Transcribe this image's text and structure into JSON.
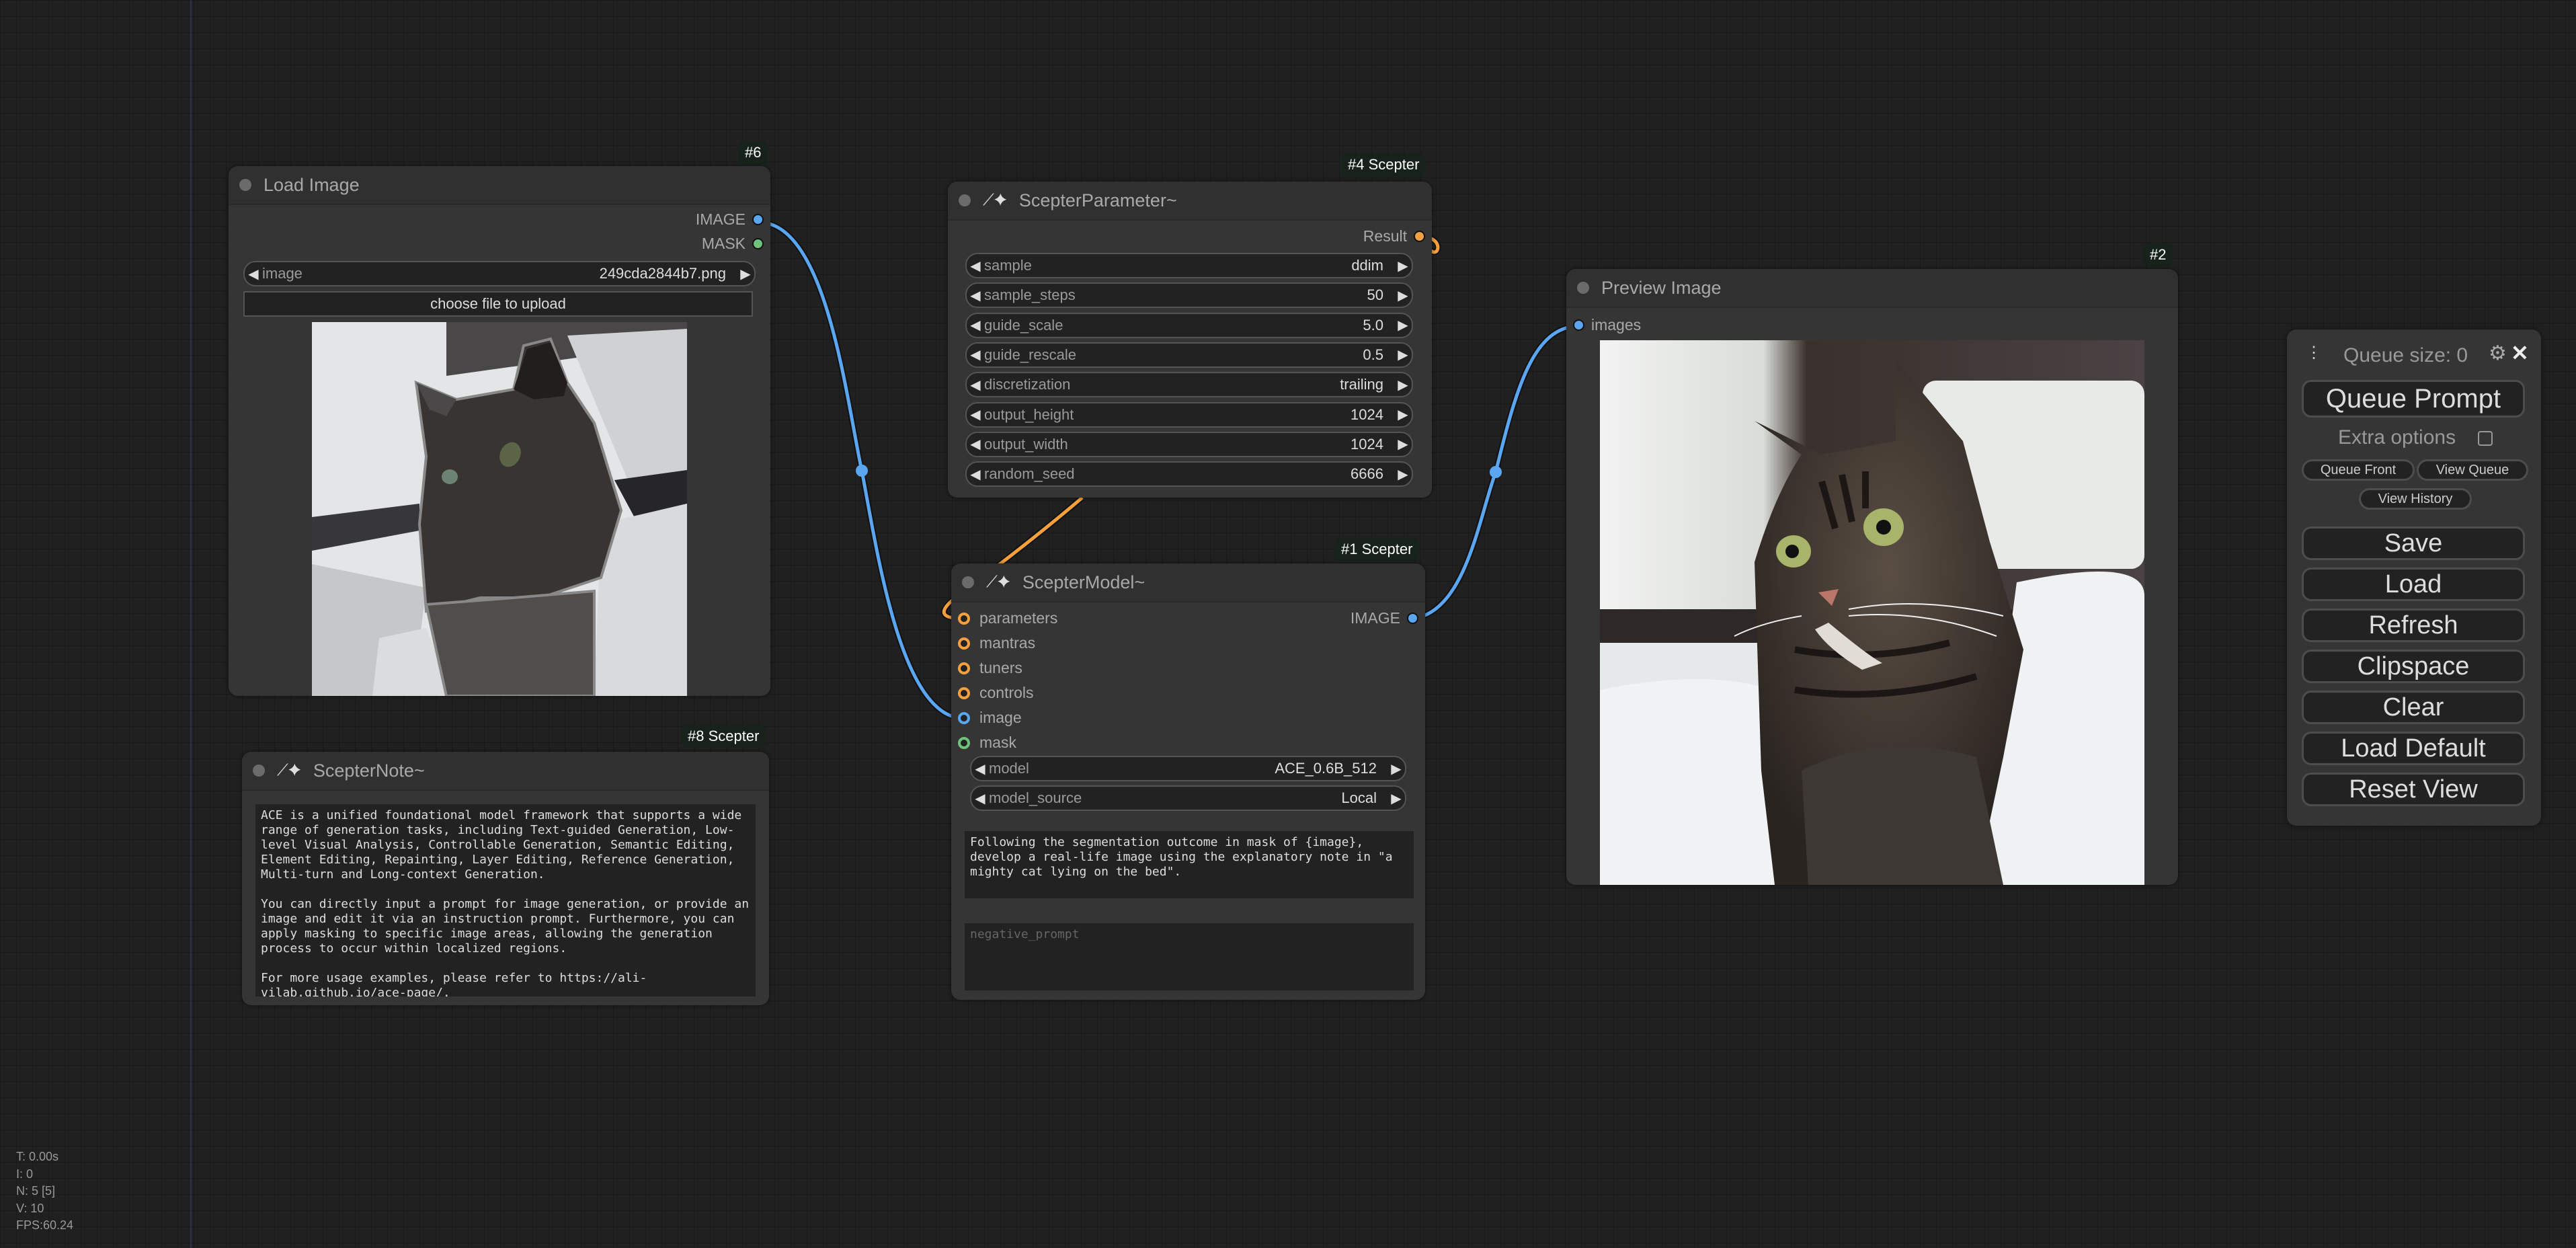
{
  "canvas": {
    "stats": [
      "T: 0.00s",
      "I: 0",
      "N: 5 [5]",
      "V: 10",
      "FPS:60.24"
    ]
  },
  "colors": {
    "image_link": "#5aa6f0",
    "mask_port": "#6fc27a",
    "scepter_link": "#f5a03c",
    "badge_bg": "#16221a"
  },
  "nodes": {
    "load_image": {
      "badge": "#6",
      "title": "Load Image",
      "outputs": [
        "IMAGE",
        "MASK"
      ],
      "widget": {
        "label": "image",
        "value": "249cda2844b7.png"
      },
      "upload_label": "choose file to upload",
      "preview_alt": "segmentation mask of cat"
    },
    "scepter_note": {
      "badge": "#8 Scepter",
      "title": "ScepterNote~",
      "icon": "magic-wand-icon",
      "text": "ACE is a unified foundational model framework that supports a wide range of generation tasks, including Text-guided Generation, Low-level Visual Analysis, Controllable Generation, Semantic Editing, Element Editing, Repainting, Layer Editing, Reference Generation, Multi-turn and Long-context Generation.\n\nYou can directly input a prompt for image generation, or provide an image and edit it via an instruction prompt. Furthermore, you can apply masking to specific image areas, allowing the generation process to occur within localized regions.\n\nFor more usage examples, please refer to https://ali-vilab.github.io/ace-page/."
    },
    "scepter_parameter": {
      "badge": "#4 Scepter",
      "title": "ScepterParameter~",
      "icon": "magic-wand-icon",
      "output": "Result",
      "widgets": [
        {
          "label": "sample",
          "value": "ddim"
        },
        {
          "label": "sample_steps",
          "value": "50"
        },
        {
          "label": "guide_scale",
          "value": "5.0"
        },
        {
          "label": "guide_rescale",
          "value": "0.5"
        },
        {
          "label": "discretization",
          "value": "trailing"
        },
        {
          "label": "output_height",
          "value": "1024"
        },
        {
          "label": "output_width",
          "value": "1024"
        },
        {
          "label": "random_seed",
          "value": "6666"
        }
      ]
    },
    "scepter_model": {
      "badge": "#1 Scepter",
      "title": "ScepterModel~",
      "icon": "magic-wand-icon",
      "inputs": [
        "parameters",
        "mantras",
        "tuners",
        "controls",
        "image",
        "mask"
      ],
      "output": "IMAGE",
      "widgets": [
        {
          "label": "model",
          "value": "ACE_0.6B_512"
        },
        {
          "label": "model_source",
          "value": "Local"
        }
      ],
      "prompt": "Following the segmentation outcome in mask of {image}, develop a real-life image using the explanatory note in \"a mighty cat lying on the bed\".",
      "negative_prompt_placeholder": "negative_prompt"
    },
    "preview_image": {
      "badge": "#2",
      "title": "Preview Image",
      "input": "images",
      "preview_alt": "generated tabby cat lying on bed"
    }
  },
  "panel": {
    "queue_size": "Queue size: 0",
    "queue_prompt": "Queue Prompt",
    "extra_options": "Extra options",
    "extra_options_checked": false,
    "queue_front": "Queue Front",
    "view_queue": "View Queue",
    "view_history": "View History",
    "buttons": [
      "Save",
      "Load",
      "Refresh",
      "Clipspace",
      "Clear",
      "Load Default",
      "Reset View"
    ]
  }
}
